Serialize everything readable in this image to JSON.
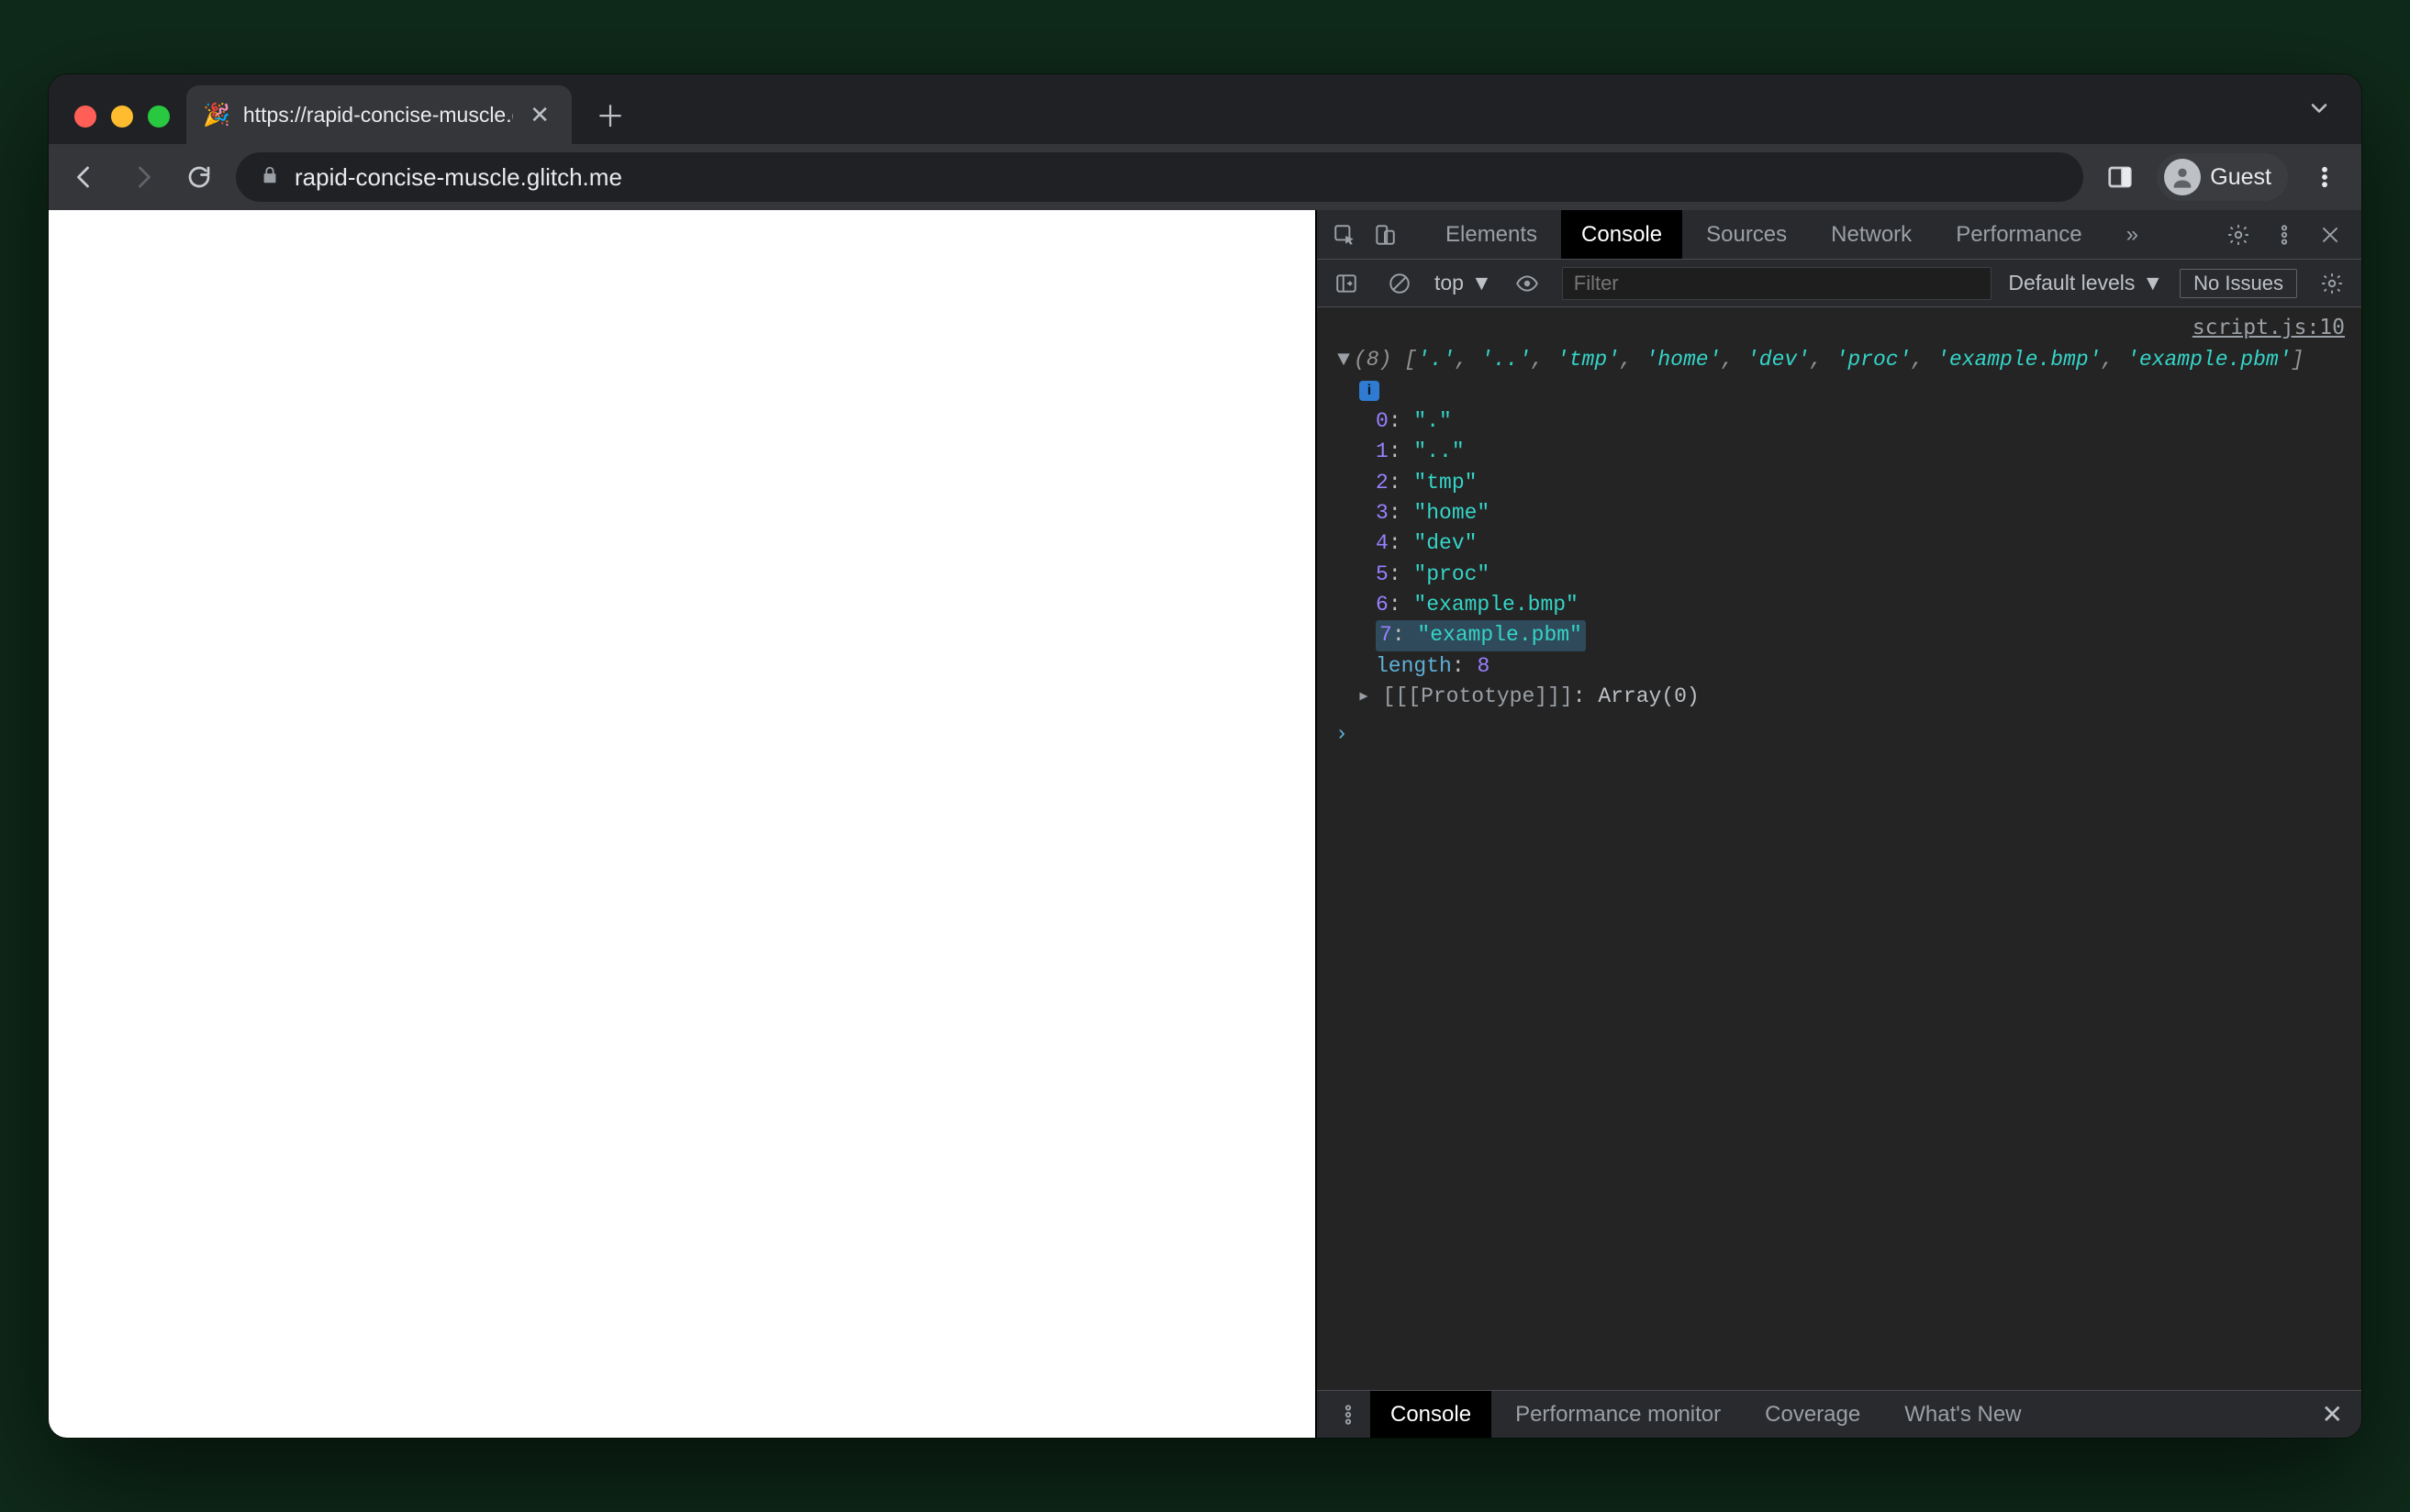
{
  "browser": {
    "tab_title": "https://rapid-concise-muscle.g",
    "favicon": "🎉",
    "url_display": "rapid-concise-muscle.glitch.me",
    "profile_label": "Guest"
  },
  "devtools": {
    "tabs": [
      "Elements",
      "Console",
      "Sources",
      "Network",
      "Performance"
    ],
    "active_tab": "Console",
    "more_tabs_glyph": "»",
    "console_toolbar": {
      "context": "top",
      "filter_placeholder": "Filter",
      "levels": "Default levels",
      "issues": "No Issues"
    },
    "source_link": "script.js:10",
    "array_length_label": "(8)",
    "array_summary": [
      "'.'",
      "'..'",
      "'tmp'",
      "'home'",
      "'dev'",
      "'proc'",
      "'example.bmp'",
      "'example.pbm'"
    ],
    "array_items": [
      {
        "index": "0",
        "value": "\".\""
      },
      {
        "index": "1",
        "value": "\"..\""
      },
      {
        "index": "2",
        "value": "\"tmp\""
      },
      {
        "index": "3",
        "value": "\"home\""
      },
      {
        "index": "4",
        "value": "\"dev\""
      },
      {
        "index": "5",
        "value": "\"proc\""
      },
      {
        "index": "6",
        "value": "\"example.bmp\""
      },
      {
        "index": "7",
        "value": "\"example.pbm\""
      }
    ],
    "highlight_index": 7,
    "length_key": "length",
    "length_value": "8",
    "prototype_label": "[[Prototype]]",
    "prototype_value": "Array(0)",
    "drawer_tabs": [
      "Console",
      "Performance monitor",
      "Coverage",
      "What's New"
    ],
    "drawer_active": "Console"
  }
}
